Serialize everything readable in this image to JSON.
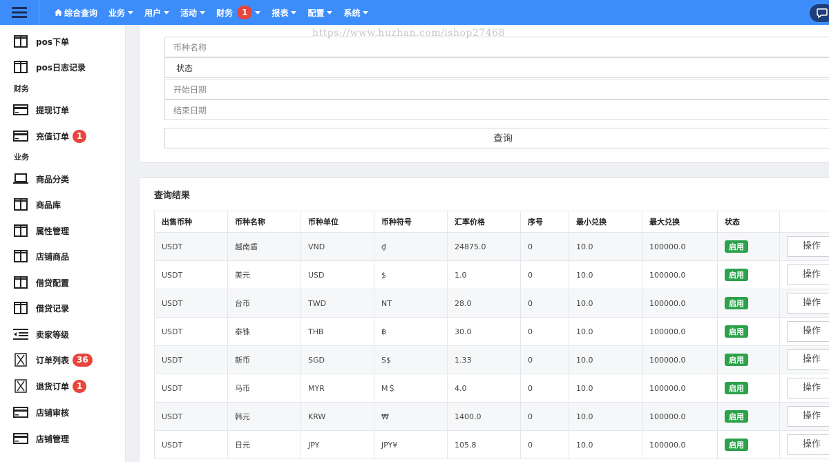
{
  "topbar": {
    "nav": [
      {
        "label": "综合查询",
        "icon": "home-icon",
        "caret": false
      },
      {
        "label": "业务",
        "caret": true
      },
      {
        "label": "用户",
        "caret": true
      },
      {
        "label": "活动",
        "caret": true
      },
      {
        "label": "财务",
        "caret": true,
        "badge": "1"
      },
      {
        "label": "报表",
        "caret": true
      },
      {
        "label": "配置",
        "caret": true
      },
      {
        "label": "系统",
        "caret": true
      }
    ],
    "brand_color": "#3c8dfa"
  },
  "watermark": "https://www.huzhan.com/ishop27468",
  "sidebar": {
    "items": [
      {
        "label": "pos下单",
        "icon": "columns-icon"
      },
      {
        "label": "pos日志记录",
        "icon": "columns-icon"
      },
      {
        "label": "提现订单",
        "icon": "credit-card-icon"
      },
      {
        "label": "充值订单",
        "icon": "credit-card-icon",
        "badge": "1"
      },
      {
        "label": "商品分类",
        "icon": "laptop-icon"
      },
      {
        "label": "商品库",
        "icon": "columns-icon"
      },
      {
        "label": "属性管理",
        "icon": "columns-icon"
      },
      {
        "label": "店铺商品",
        "icon": "columns-icon"
      },
      {
        "label": "借贷配置",
        "icon": "columns-icon"
      },
      {
        "label": "借贷记录",
        "icon": "columns-icon"
      },
      {
        "label": "卖家等级",
        "icon": "outdent-icon"
      },
      {
        "label": "订单列表",
        "icon": "hourglass-icon",
        "badge": "36"
      },
      {
        "label": "退货订单",
        "icon": "hourglass-icon",
        "badge": "1"
      },
      {
        "label": "店铺审核",
        "icon": "credit-card-icon"
      },
      {
        "label": "店铺管理",
        "icon": "credit-card-icon"
      }
    ],
    "sections": [
      "财务",
      "业务"
    ]
  },
  "filter": {
    "currency_name_placeholder": "币种名称",
    "status_label": "状态",
    "start_date_placeholder": "开始日期",
    "end_date_placeholder": "结束日期",
    "query_label": "查询"
  },
  "results": {
    "title": "查询结果",
    "columns": [
      "出售币种",
      "币种名称",
      "币种单位",
      "币种符号",
      "汇率价格",
      "序号",
      "最小兑换",
      "最大兑换",
      "状态",
      ""
    ],
    "rows": [
      [
        "USDT",
        "越南盾",
        "VND",
        "₫",
        "24875.0",
        "0",
        "10.0",
        "100000.0",
        "启用",
        "操作"
      ],
      [
        "USDT",
        "美元",
        "USD",
        "$",
        "1.0",
        "0",
        "10.0",
        "100000.0",
        "启用",
        "操作"
      ],
      [
        "USDT",
        "台币",
        "TWD",
        "NT",
        "28.0",
        "0",
        "10.0",
        "100000.0",
        "启用",
        "操作"
      ],
      [
        "USDT",
        "泰铢",
        "THB",
        "฿",
        "30.0",
        "0",
        "10.0",
        "100000.0",
        "启用",
        "操作"
      ],
      [
        "USDT",
        "新币",
        "SGD",
        "S$",
        "1.33",
        "0",
        "10.0",
        "100000.0",
        "启用",
        "操作"
      ],
      [
        "USDT",
        "马币",
        "MYR",
        "M＄",
        "4.0",
        "0",
        "10.0",
        "100000.0",
        "启用",
        "操作"
      ],
      [
        "USDT",
        "韩元",
        "KRW",
        "₩",
        "1400.0",
        "0",
        "10.0",
        "100000.0",
        "启用",
        "操作"
      ],
      [
        "USDT",
        "日元",
        "JPY",
        "JPY¥",
        "105.8",
        "0",
        "10.0",
        "100000.0",
        "启用",
        "操作"
      ]
    ],
    "status_color": "#2ca24b"
  }
}
